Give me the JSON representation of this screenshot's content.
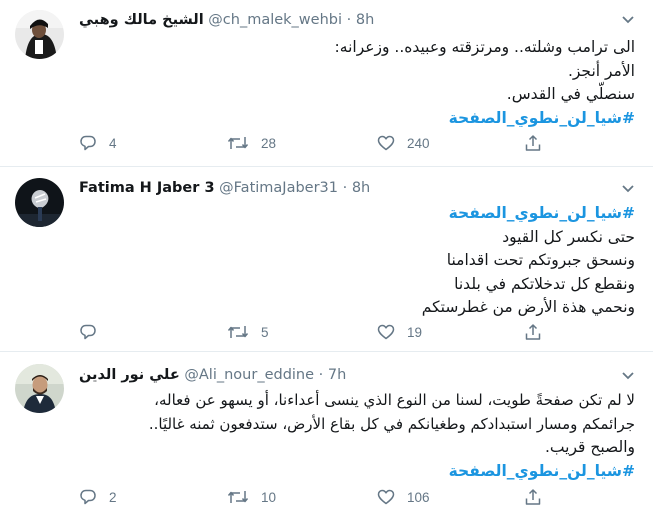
{
  "colors": {
    "link": "#1b95e0",
    "muted": "#657786",
    "text": "#14171a",
    "border": "#e6ecf0"
  },
  "tweets": [
    {
      "name": "الشيخ مالك وهبي",
      "handle": "@ch_malek_wehbi",
      "separator": "·",
      "time": "8h",
      "lines": [
        "الى ترامب وشلته.. ومرتزقته وعبيده.. وزعرانه:",
        "الأمر أنجز.",
        "سنصلّي في القدس."
      ],
      "hashtag": "#شيا_لن_نطوي_الصفحة",
      "replies": "4",
      "retweets": "28",
      "likes": "240",
      "icons": {
        "reply": "reply-icon",
        "retweet": "retweet-icon",
        "like": "heart-icon",
        "share": "share-icon",
        "menu": "chevron-down-icon"
      }
    },
    {
      "name": "Fatima H Jaber 3",
      "handle": "@FatimaJaber31",
      "separator": "·",
      "time": "8h",
      "hashtag": "#شيا_لن_نطوي_الصفحة",
      "lines": [
        "حتى نكسر كل القيود",
        "ونسحق جبروتكم تحت اقدامنا",
        "ونقطع كل تدخلاتكم في بلدنا",
        "ونحمي هذة الأرض من غطرستكم"
      ],
      "replies": "",
      "retweets": "5",
      "likes": "19",
      "icons": {
        "reply": "reply-icon",
        "retweet": "retweet-icon",
        "like": "heart-icon",
        "share": "share-icon",
        "menu": "chevron-down-icon"
      }
    },
    {
      "name": "علي نور الدين",
      "handle": "@Ali_nour_eddine",
      "separator": "·",
      "time": "7h",
      "lines": [
        "لا لم تكن صفحةً طويت، لسنا من النوع الذي ينسى أعداءنا، أو يسهو عن فعاله،",
        "جرائمكم ومسار استبدادكم وطغيانكم في كل بقاع الأرض، ستدفعون ثمنه غاليًا..",
        "والصبح قريب."
      ],
      "hashtag": "#شيا_لن_نطوي_الصفحة",
      "replies": "2",
      "retweets": "10",
      "likes": "106",
      "icons": {
        "reply": "reply-icon",
        "retweet": "retweet-icon",
        "like": "heart-icon",
        "share": "share-icon",
        "menu": "chevron-down-icon"
      }
    }
  ]
}
